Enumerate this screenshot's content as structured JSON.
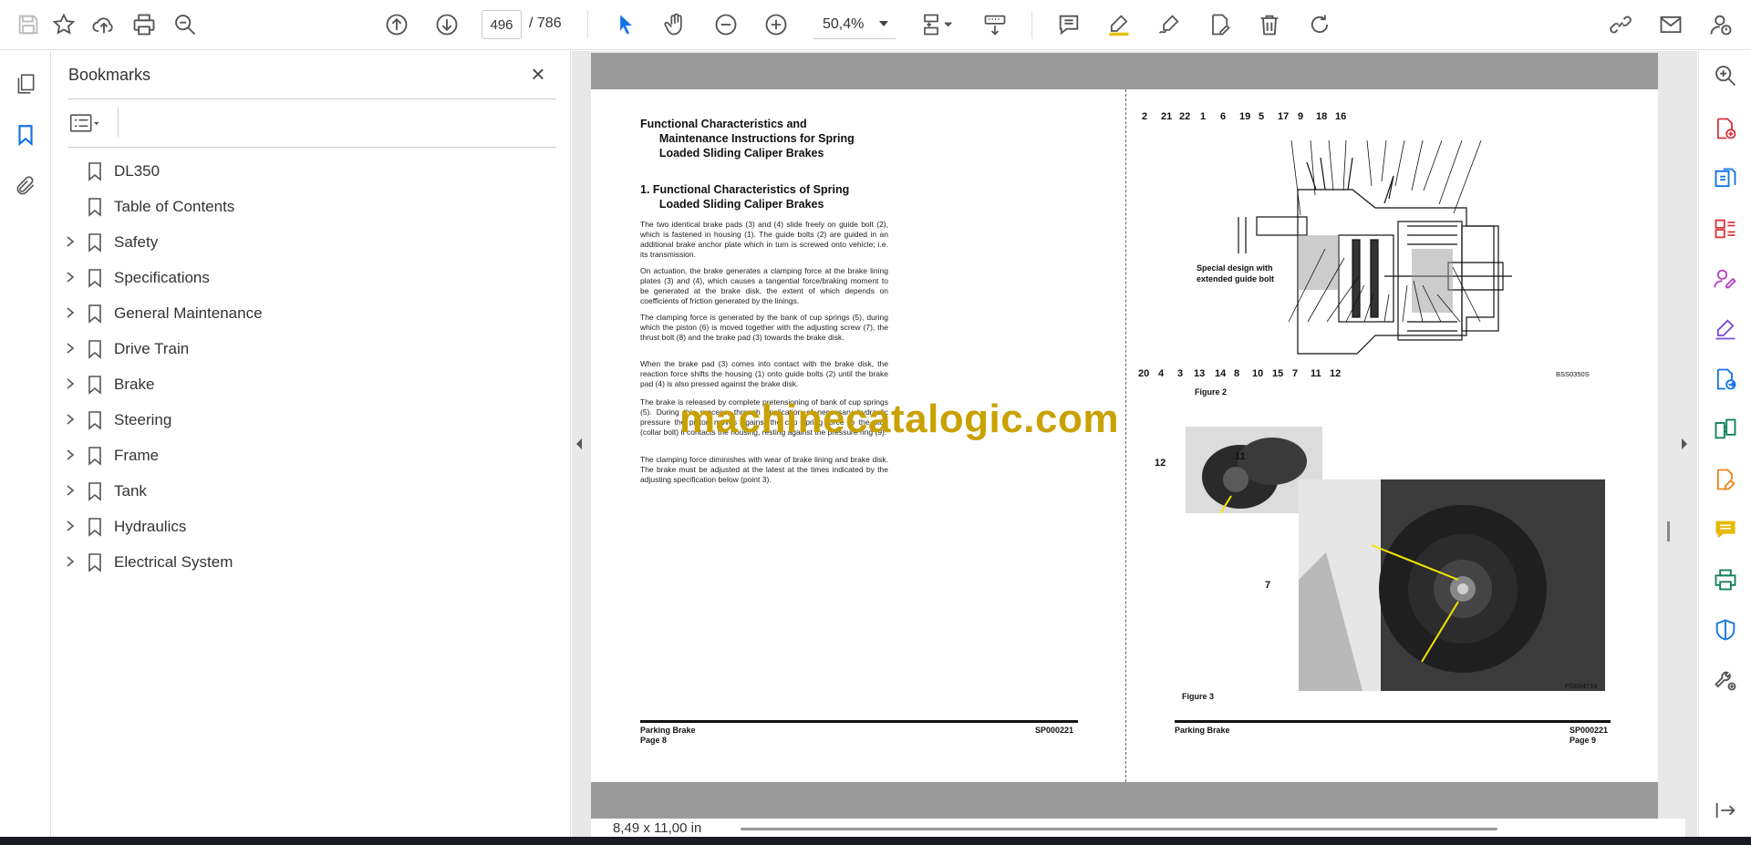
{
  "toolbar": {
    "current_page": "496",
    "total_pages": "/ 786",
    "zoom": "50,4%"
  },
  "bookmarks": {
    "title": "Bookmarks",
    "items": [
      {
        "label": "DL350",
        "expandable": false
      },
      {
        "label": "Table of Contents",
        "expandable": false
      },
      {
        "label": "Safety",
        "expandable": true
      },
      {
        "label": "Specifications",
        "expandable": true
      },
      {
        "label": "General Maintenance",
        "expandable": true
      },
      {
        "label": "Drive Train",
        "expandable": true
      },
      {
        "label": "Brake",
        "expandable": true
      },
      {
        "label": "Steering",
        "expandable": true
      },
      {
        "label": "Frame",
        "expandable": true
      },
      {
        "label": "Tank",
        "expandable": true
      },
      {
        "label": "Hydraulics",
        "expandable": true
      },
      {
        "label": "Electrical System",
        "expandable": true
      }
    ]
  },
  "document": {
    "left_page": {
      "heading": "Functional Characteristics and\n      Maintenance Instructions for Spring\n      Loaded Sliding Caliper Brakes",
      "section": "1. Functional Characteristics of Spring\n      Loaded Sliding Caliper Brakes",
      "paragraphs": [
        "The two identical brake pads (3) and (4) slide freely on guide bolt (2), which is fastened in housing (1). The guide bolts (2) are guided in an additional brake anchor plate which in turn is screwed onto vehicle; i.e. its transmission.",
        "On actuation, the brake generates a clamping force at the brake lining plates (3) and (4), which causes a tangential force/braking moment to be generated at the brake disk, the extent of which depends on coefficients of friction generated by the linings.",
        "The clamping force is generated by the bank of cup springs (5), during which the piston (6) is moved together with the adjusting screw (7), the thrust bolt (8) and the brake pad (3) towards the brake disk.",
        "When the brake pad (3) comes into contact with the brake disk, the reaction force shifts the housing (1) onto guide bolts (2) until the brake pad (4) is also pressed against the brake disk.",
        "The brake is released by complete pretensioning of bank of cup springs (5). During this process, through application of necessary hydraulic pressure the piston moves against the cup spring force to the stop (collar bolt) it contacts the housing, resting against the pressure ring (9).",
        "The clamping force diminishes with wear of brake lining and brake disk. The brake must be adjusted at the latest at the times indicated by the adjusting specification below (point 3)."
      ],
      "footer_left": "Parking Brake",
      "footer_page": "Page 8",
      "footer_right": "SP000221"
    },
    "right_page": {
      "figure2_callouts_top": [
        "2",
        "21",
        "22",
        "1",
        "6",
        "19",
        "5",
        "17",
        "9",
        "18",
        "16"
      ],
      "figure2_callouts_bottom": [
        "20",
        "4",
        "3",
        "13",
        "14",
        "8",
        "10",
        "15",
        "7",
        "11",
        "12"
      ],
      "figure2_note": "Special design with\nextended guide bolt",
      "figure2_code": "BSS0350S",
      "figure2_caption": "Figure 2",
      "figure3_callouts": [
        "12",
        "11",
        "7"
      ],
      "figure3_code": "FG004719",
      "figure3_caption": "Figure 3",
      "footer_left": "Parking Brake",
      "footer_page": "Page 9",
      "footer_right": "SP000221"
    },
    "watermark": "machinecatalogic.com"
  },
  "status": {
    "page_size": "8,49 x 11,00 in"
  },
  "colors": {
    "accent": "#1473e6",
    "watermark": "#c9a100",
    "callout_line": "#f2e600"
  }
}
